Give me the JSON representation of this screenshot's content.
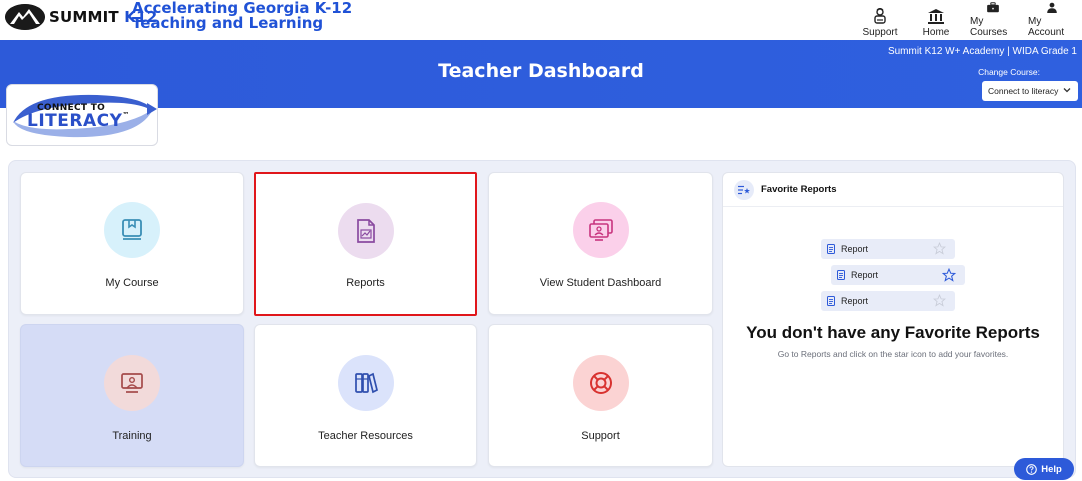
{
  "header": {
    "logo_brand": "SUMMIT",
    "logo_k12": "K12",
    "tagline_line1": "Accelerating Georgia K-12",
    "tagline_line2": "Teaching and Learning",
    "nav": [
      {
        "label": "Support",
        "icon": "support-person-icon"
      },
      {
        "label": "Home",
        "icon": "home-building-icon"
      },
      {
        "label": "My Courses",
        "icon": "briefcase-icon"
      },
      {
        "label": "My Account",
        "icon": "user-icon"
      }
    ]
  },
  "band": {
    "title": "Teacher Dashboard",
    "school": "Summit K12 W+ Academy | WIDA Grade 1",
    "change_course_label": "Change Course:",
    "course_selected": "Connect to literacy"
  },
  "program_badge": {
    "line1": "CONNECT TO",
    "line2": "LITERACY",
    "trademark": "™"
  },
  "tiles": [
    {
      "id": "my-course",
      "label": "My Course",
      "icon": "book-icon",
      "circle_color": "#d7f1fb"
    },
    {
      "id": "reports",
      "label": "Reports",
      "icon": "report-document-icon",
      "circle_color": "#ecdcef"
    },
    {
      "id": "view-student-dashboard",
      "label": "View Student Dashboard",
      "icon": "student-screens-icon",
      "circle_color": "#fbd0ea"
    },
    {
      "id": "training",
      "label": "Training",
      "icon": "presentation-icon",
      "circle_color": "#f2dada"
    },
    {
      "id": "teacher-resources",
      "label": "Teacher Resources",
      "icon": "books-icon",
      "circle_color": "#dbe3fb"
    },
    {
      "id": "support",
      "label": "Support",
      "icon": "lifebuoy-icon",
      "circle_color": "#fbd3d3"
    }
  ],
  "favorites": {
    "title": "Favorite Reports",
    "mock_items": [
      "Report",
      "Report",
      "Report"
    ],
    "empty_title": "You don't have any Favorite Reports",
    "empty_subtitle": "Go to Reports and click on the star icon to add your favorites."
  },
  "help": {
    "label": "Help"
  },
  "colors": {
    "brand_blue": "#2d5ad9",
    "selected_outline": "#e0161b",
    "panel_bg": "#eceff8"
  }
}
